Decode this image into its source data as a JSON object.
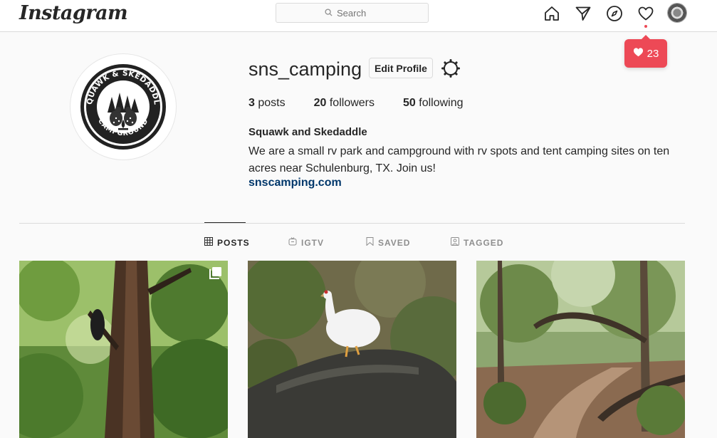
{
  "header": {
    "logo": "Instagram",
    "search_placeholder": "Search",
    "nav": [
      {
        "name": "home-icon"
      },
      {
        "name": "direct-icon"
      },
      {
        "name": "explore-icon"
      },
      {
        "name": "activity-icon"
      }
    ],
    "notification_count": "23",
    "accent_color": "#ed4956"
  },
  "profile": {
    "username": "sns_camping",
    "edit_label": "Edit Profile",
    "posts_count": "3",
    "posts_label": "posts",
    "followers_count": "20",
    "followers_label": "followers",
    "following_count": "50",
    "following_label": "following",
    "full_name": "Squawk and Skedaddle",
    "bio": "We are a small rv park and campground with rv spots and tent camping sites on ten acres near Schulenburg, TX. Join us!",
    "website": "snscamping.com",
    "link_color": "#00376b",
    "avatar_logo_top": "SQUAWK & SKEDADDLE",
    "avatar_logo_bottom": "CAMPGROUND"
  },
  "tabs": [
    {
      "label": "POSTS",
      "icon": "grid-icon",
      "active": true
    },
    {
      "label": "IGTV",
      "icon": "igtv-icon",
      "active": false
    },
    {
      "label": "SAVED",
      "icon": "bookmark-icon",
      "active": false
    },
    {
      "label": "TAGGED",
      "icon": "tagged-icon",
      "active": false
    }
  ],
  "posts": [
    {
      "subject": "forest-tree",
      "multi": true
    },
    {
      "subject": "white-guinea-fowl-on-log",
      "multi": false
    },
    {
      "subject": "forest-trail",
      "multi": false
    }
  ]
}
